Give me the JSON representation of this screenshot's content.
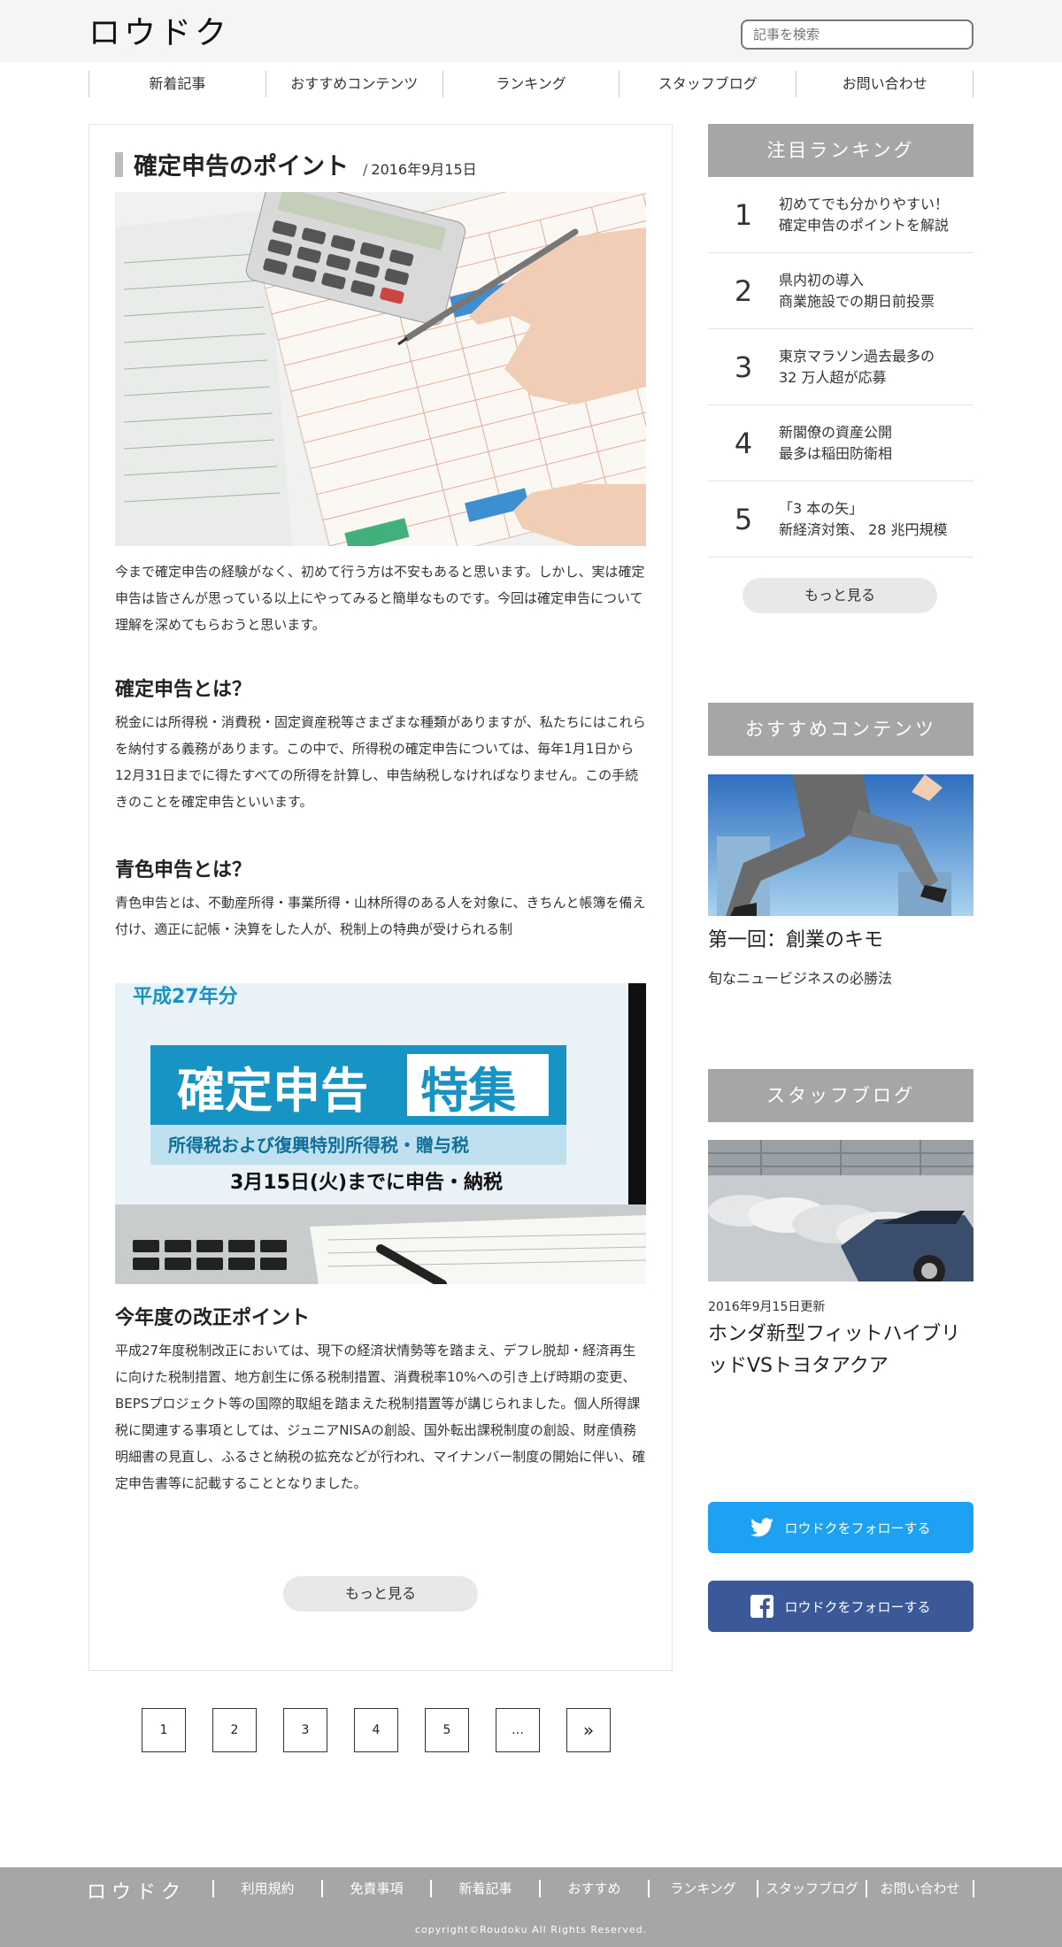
{
  "header": {
    "logo": "ロウドク",
    "search_placeholder": "記事を検索"
  },
  "nav": {
    "items": [
      "新着記事",
      "おすすめコンテンツ",
      "ランキング",
      "スタッフブログ",
      "お問い合わせ"
    ]
  },
  "article": {
    "title": "確定申告のポイント",
    "date": "2016年9月15日",
    "intro": "今まで確定申告の経験がなく、初めて行う方は不安もあると思います。しかし、実は確定申告は皆さんが思っている以上にやってみると簡単なものです。今回は確定申告について理解を深めてもらおうと思います。",
    "section1_heading": "確定申告とは？",
    "section1_body": "税金には所得税・消費税・固定資産税等さまざまな種類がありますが、私たちにはこれらを納付する義務があります。この中で、所得税の確定申告については、毎年1月1日から12月31日までに得たすべての所得を計算し、申告納税しなければなりません。この手続きのことを確定申告といいます。",
    "section2_heading": "青色申告とは？",
    "section2_body": "青色申告とは、不動産所得・事業所得・山林所得のある人を対象に、きちんと帳簿を備え付け、適正に記帳・決算をした人が、税制上の特典が受けられる制",
    "image2": {
      "line1": "平成27年分",
      "line2a": "確定申告",
      "line2b": "特集",
      "line3": "所得税および復興特別所得税・贈与税",
      "line4": "3月15日(火)までに申告・納税"
    },
    "section3_heading": "今年度の改正ポイント",
    "section3_body": "平成27年度税制改正においては、現下の経済状情勢等を踏まえ、デフレ脱却・経済再生に向けた税制措置、地方創生に係る税制措置、消費税率10%への引き上げ時期の変更、BEPSプロジェクト等の国際的取組を踏まえた税制措置等が講じられました。個人所得課税に関連する事項としては、ジュニアNISAの創設、国外転出課税制度の創設、財産債務明細書の見直し、ふるさと納税の拡充などが行われ、マイナンバー制度の開始に伴い、確定申告書等に記載することとなりました。",
    "more_label": "もっと見る"
  },
  "pagination": {
    "pages": [
      "1",
      "2",
      "3",
      "4",
      "5",
      "…",
      "»"
    ]
  },
  "sidebar": {
    "ranking": {
      "heading": "注目ランキング",
      "items": [
        {
          "num": "1",
          "line1": "初めてでも分かりやすい！",
          "line2": "確定申告のポイントを解説"
        },
        {
          "num": "2",
          "line1": "県内初の導入",
          "line2": "商業施設での期日前投票"
        },
        {
          "num": "3",
          "line1": "東京マラソン過去最多の",
          "line2": "32 万人超が応募"
        },
        {
          "num": "4",
          "line1": "新閣僚の資産公開",
          "line2": "最多は稲田防衛相"
        },
        {
          "num": "5",
          "line1": "「3 本の矢」",
          "line2": "新経済対策、 28 兆円規模"
        }
      ],
      "more_label": "もっと見る"
    },
    "recommend": {
      "heading": "おすすめコンテンツ",
      "title": "第一回：創業のキモ",
      "subtitle": "旬なニュービジネスの必勝法"
    },
    "blog": {
      "heading": "スタッフブログ",
      "date": "2016年9月15日更新",
      "title": "ホンダ新型フィットハイブリッドVSトヨタアクア"
    },
    "social": {
      "twitter_label": "ロウドクをフォローする",
      "facebook_label": "ロウドクをフォローする",
      "twitter_color": "#1da1f2",
      "facebook_color": "#3b5998"
    }
  },
  "footer": {
    "logo": "ロウドク",
    "links": [
      "利用規約",
      "免責事項",
      "新着記事",
      "おすすめ",
      "ランキング",
      "スタッフブログ",
      "お問い合わせ"
    ],
    "copyright": "copyright©Roudoku All Rights Reserved."
  }
}
